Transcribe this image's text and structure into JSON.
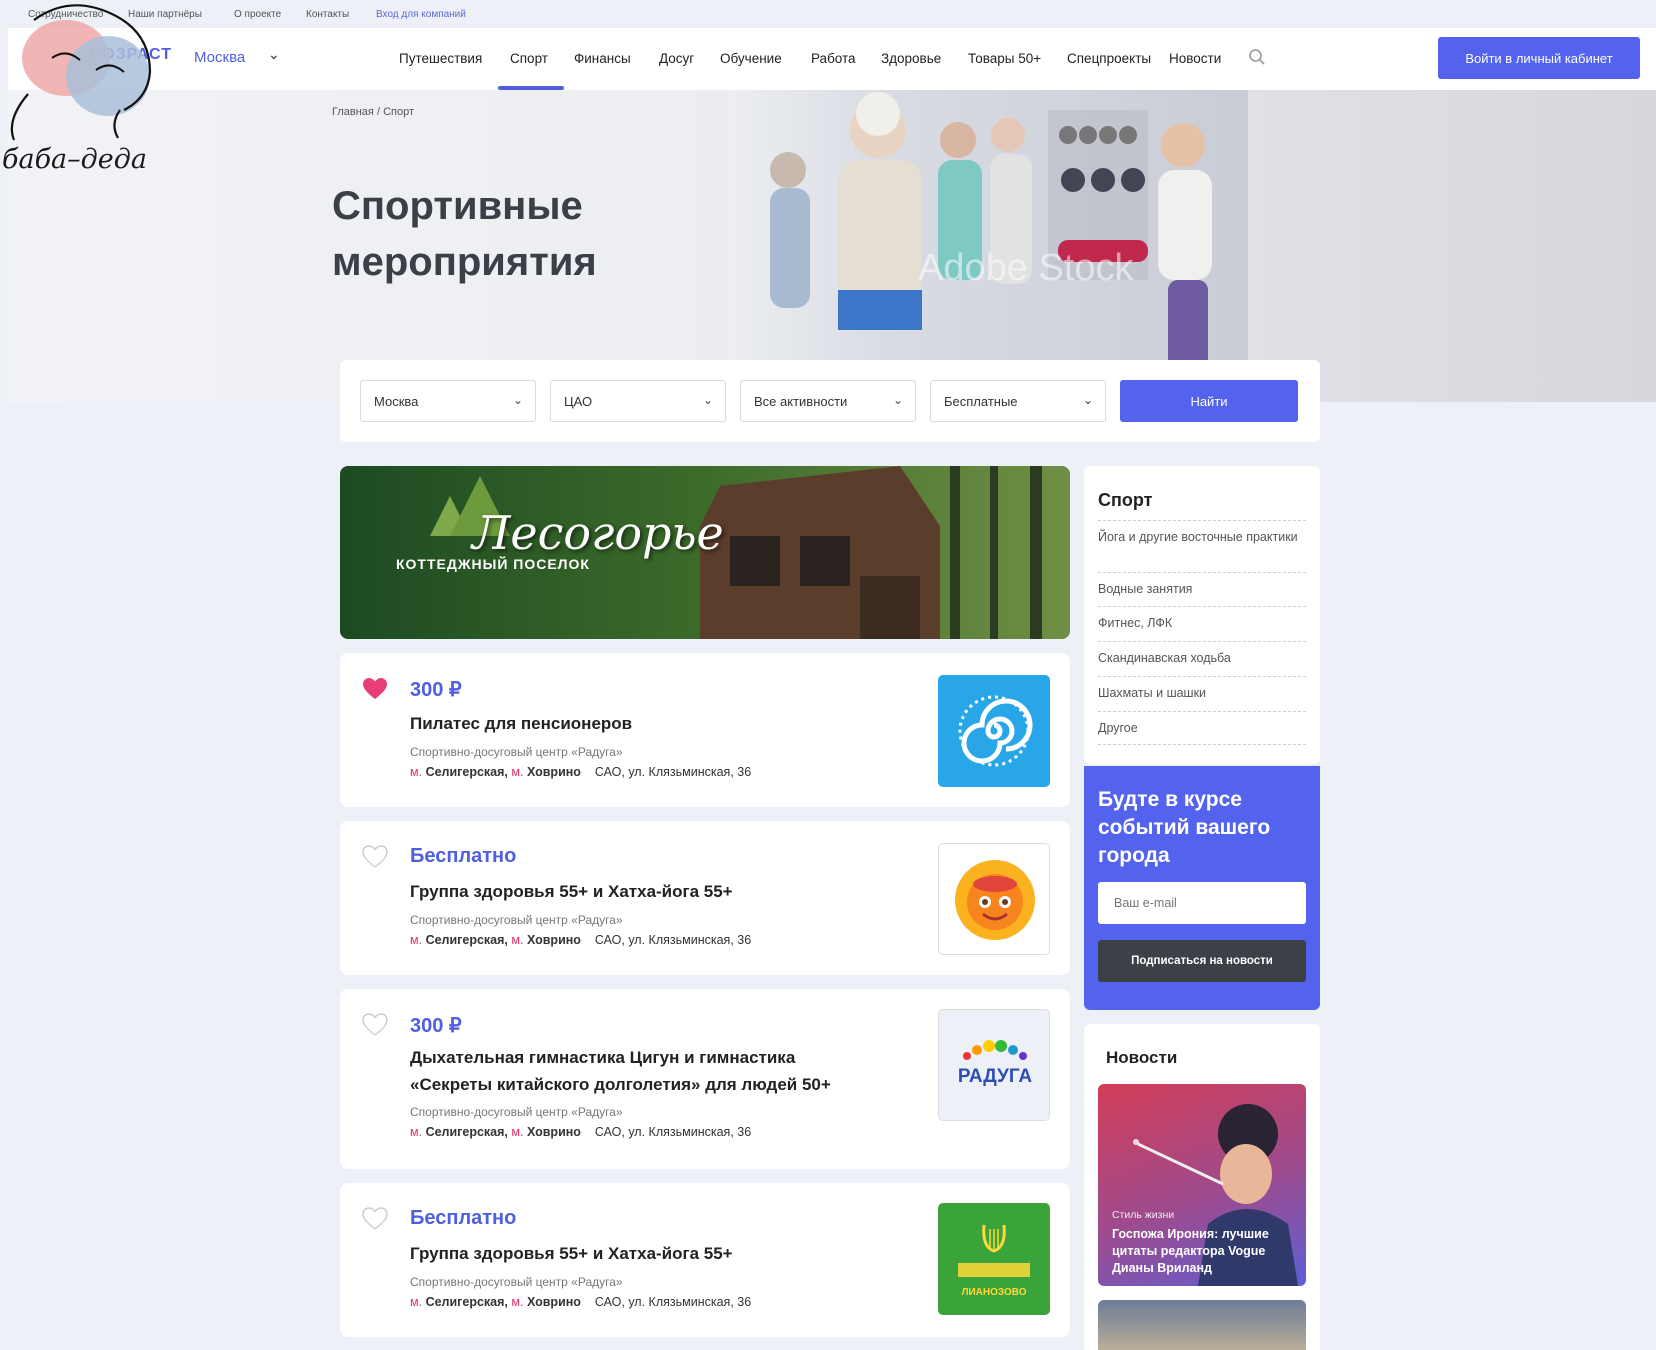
{
  "top_links": {
    "cooperation": "Сотрудничество",
    "partners": "Наши партнёры",
    "about": "О проекте",
    "contacts": "Контакты",
    "company_login": "Вход для компаний"
  },
  "header": {
    "logo": "ВОЗРАСТ",
    "city": "Москва",
    "login_button": "Войти в личный кабинет",
    "nav": [
      "Путешествия",
      "Спорт",
      "Финансы",
      "Досуг",
      "Обучение",
      "Работа",
      "Здоровье",
      "Товары 50+",
      "Спецпроекты",
      "Новости"
    ],
    "active_nav": "Спорт"
  },
  "breadcrumb": {
    "home": "Главная",
    "sep": "/",
    "current": "Спорт"
  },
  "hero": {
    "title_line1": "Спортивные",
    "title_line2": "мероприятия",
    "watermark": "Adobe Stock"
  },
  "filters": {
    "city": "Москва",
    "district": "ЦАО",
    "activity": "Все активности",
    "price": "Бесплатные",
    "find_button": "Найти"
  },
  "banner": {
    "title": "Лесогорье",
    "subtitle": "КОТТЕДЖНЫЙ ПОСЕЛОК"
  },
  "events": [
    {
      "price": "300 ₽",
      "title": "Пилатес для пенсионеров",
      "org": "Спортивно-досуговый центр «Радуга»",
      "m": "м.",
      "metro1": "Селигерская,",
      "metro2": "Ховрино",
      "address": "САО, ул. Клязьминская, 36",
      "favorited": true
    },
    {
      "price": "Бесплатно",
      "title": "Группа здоровья 55+ и Хатха-йога 55+",
      "org": "Спортивно-досуговый центр «Радуга»",
      "m": "м.",
      "metro1": "Селигерская,",
      "metro2": "Ховрино",
      "address": "САО, ул. Клязьминская, 36",
      "favorited": false
    },
    {
      "price": "300 ₽",
      "title": "Дыхательная гимнастика Цигун и гимнастика «Секреты китайского долголетия» для людей 50+",
      "org": "Спортивно-досуговый центр «Радуга»",
      "m": "м.",
      "metro1": "Селигерская,",
      "metro2": "Ховрино",
      "address": "САО, ул. Клязьминская, 36",
      "favorited": false
    },
    {
      "price": "Бесплатно",
      "title": "Группа здоровья 55+ и Хатха-йога 55+",
      "org": "Спортивно-досуговый центр «Радуга»",
      "m": "м.",
      "metro1": "Селигерская,",
      "metro2": "Ховрино",
      "address": "САО, ул. Клязьминская, 36",
      "favorited": false
    }
  ],
  "logos": {
    "raduga": "РАДУГА",
    "lianozovo": "ЛИАНОЗОВО"
  },
  "sidebar": {
    "title": "Спорт",
    "items": [
      "Йога и другие восточные практики",
      "Водные занятия",
      "Фитнес, ЛФК",
      "Скандинавская ходьба",
      "Шахматы и шашки",
      "Другое"
    ]
  },
  "subscribe": {
    "title": "Будте в курсе событий вашего города",
    "placeholder": "Ваш e-mail",
    "button": "Подписаться на новости"
  },
  "news": {
    "title": "Новости",
    "item_category": "Стиль жизни",
    "item_title": "Госпожа Ирония: лучшие цитаты редактора Vogue Дианы Вриланд"
  },
  "overlay": {
    "text": "баба–деда"
  },
  "colors": {
    "accent": "#5463ee",
    "link": "#4f5fe0",
    "metro": "#e0336b",
    "heart": "#e83e76"
  }
}
